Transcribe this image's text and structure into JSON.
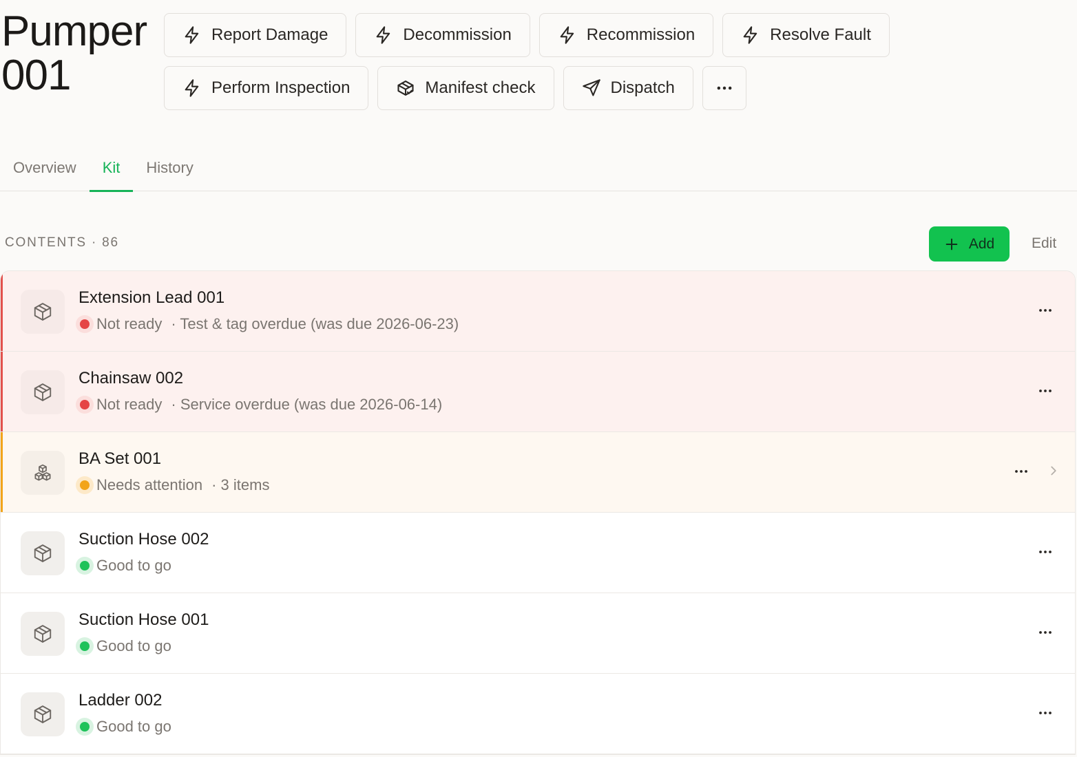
{
  "header": {
    "title_line1": "Pumper",
    "title_line2": "001"
  },
  "actions": {
    "row1": [
      {
        "label": "Report Damage",
        "icon": "lightning-icon"
      },
      {
        "label": "Decommission",
        "icon": "lightning-icon"
      },
      {
        "label": "Recommission",
        "icon": "lightning-icon"
      },
      {
        "label": "Resolve Fault",
        "icon": "lightning-icon"
      }
    ],
    "row2": [
      {
        "label": "Perform Inspection",
        "icon": "lightning-icon"
      },
      {
        "label": "Manifest check",
        "icon": "package-check-icon"
      },
      {
        "label": "Dispatch",
        "icon": "send-icon"
      }
    ],
    "more_icon": "more-horizontal-icon"
  },
  "tabs": [
    {
      "label": "Overview",
      "active": false
    },
    {
      "label": "Kit",
      "active": true
    },
    {
      "label": "History",
      "active": false
    }
  ],
  "contents": {
    "label": "CONTENTS · 86",
    "add_label": "Add",
    "edit_label": "Edit"
  },
  "colors": {
    "accent": "#16b358",
    "not_ready": "#e54545",
    "needs_attention": "#f2a419",
    "good": "#1ec25a"
  },
  "items": [
    {
      "name": "Extension Lead 001",
      "status": "Not ready",
      "detail": "· Test & tag overdue (was due 2026-06-23)",
      "tone": "red",
      "icon": "package-icon"
    },
    {
      "name": "Chainsaw 002",
      "status": "Not ready",
      "detail": "· Service overdue (was due 2026-06-14)",
      "tone": "red",
      "icon": "package-icon"
    },
    {
      "name": "BA Set 001",
      "status": "Needs attention",
      "detail": "· 3 items",
      "tone": "orange",
      "icon": "boxes-icon"
    },
    {
      "name": "Suction Hose 002",
      "status": "Good to go",
      "detail": "",
      "tone": "green",
      "icon": "package-icon"
    },
    {
      "name": "Suction Hose 001",
      "status": "Good to go",
      "detail": "",
      "tone": "green",
      "icon": "package-icon"
    },
    {
      "name": "Ladder 002",
      "status": "Good to go",
      "detail": "",
      "tone": "green",
      "icon": "package-icon"
    }
  ]
}
